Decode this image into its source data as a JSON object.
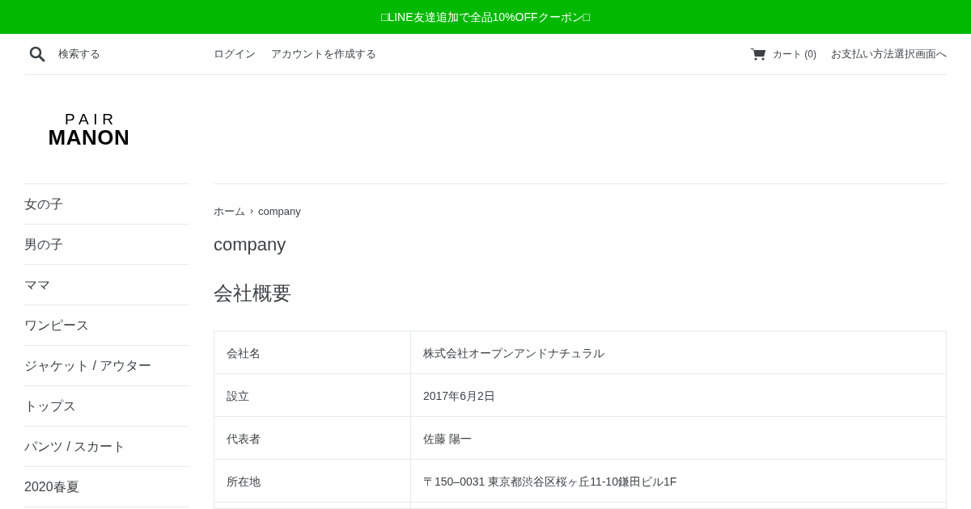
{
  "banner": {
    "text": "□LINE友達追加で全品10%OFFクーポン□"
  },
  "header": {
    "search_placeholder": "検索する",
    "links": [
      "ログイン",
      "アカウントを作成する"
    ],
    "cart": "カート (0)",
    "checkout": "お支払い方法選択画面へ"
  },
  "logo": {
    "line_1": "PAIR",
    "line_2": "MANON"
  },
  "sidebar": {
    "items": [
      "女の子",
      "男の子",
      "ママ",
      "ワンピース",
      "ジャケット / アウター",
      "トップス",
      "パンツ / スカート",
      "2020春夏"
    ]
  },
  "breadcrumb": [
    "ホーム",
    "›",
    "company"
  ],
  "page_title": "company",
  "section_title": "会社概要",
  "table": {
    "rows": [
      {
        "label": "会社名",
        "value": "株式会社オープンアンドナチュラル"
      },
      {
        "label": "設立",
        "value": "2017年6月2日"
      },
      {
        "label": "代表者",
        "value": "佐藤 陽一"
      },
      {
        "label": "所在地",
        "value": "〒150–0031 東京都渋谷区桜ヶ丘11-10鎌田ビル1F"
      }
    ]
  }
}
